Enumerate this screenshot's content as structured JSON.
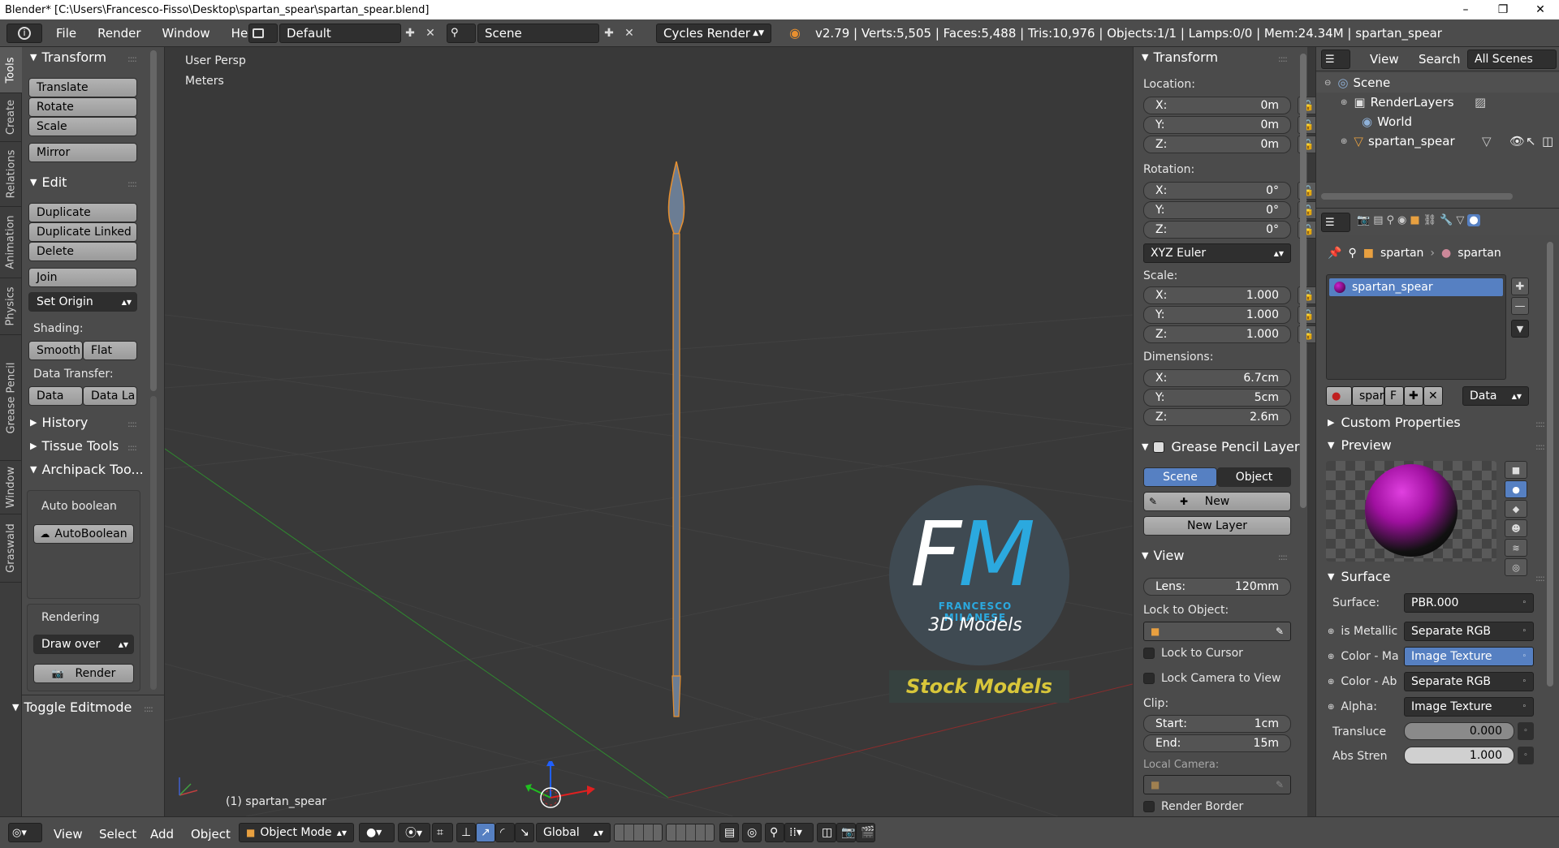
{
  "window": {
    "title": "Blender* [C:\\Users\\Francesco-Fisso\\Desktop\\spartan_spear\\spartan_spear.blend]",
    "controls": {
      "minimize": "–",
      "maximize": "❐",
      "close": "✕"
    }
  },
  "topbar": {
    "menus": [
      "File",
      "Render",
      "Window",
      "Help"
    ],
    "layout": "Default",
    "scene": "Scene",
    "engine": "Cycles Render",
    "stats": "v2.79 | Verts:5,505 | Faces:5,488 | Tris:10,976 | Objects:1/1 | Lamps:0/0 | Mem:24.34M | spartan_spear"
  },
  "tool_tabs": [
    "Tools",
    "Create",
    "Relations",
    "Animation",
    "Physics",
    "Grease Pencil",
    "Window",
    "Graswald"
  ],
  "toolshelf": {
    "transform": {
      "title": "Transform",
      "buttons": [
        "Translate",
        "Rotate",
        "Scale",
        "Mirror"
      ]
    },
    "edit": {
      "title": "Edit",
      "buttons": [
        "Duplicate",
        "Duplicate Linked",
        "Delete",
        "Join",
        "Set Origin"
      ]
    },
    "shading": {
      "label": "Shading:",
      "smooth": "Smooth",
      "flat": "Flat"
    },
    "data_transfer": {
      "label": "Data Transfer:",
      "data": "Data",
      "data_la": "Data La"
    },
    "history": "History",
    "tissue": "Tissue Tools",
    "archipack": "Archipack Too...",
    "auto_boolean_label": "Auto boolean",
    "auto_boolean_btn": "AutoBoolean",
    "rendering_label": "Rendering",
    "draw_over": "Draw over",
    "render_btn": "Render",
    "toggle_editmode": "Toggle Editmode"
  },
  "viewport": {
    "view_name": "User Persp",
    "units": "Meters",
    "object_label": "(1) spartan_spear",
    "watermark": {
      "letters": "FM",
      "name": "FRANCESCO MILANESE",
      "sub": "3D Models",
      "stock": "Stock Models"
    }
  },
  "npanel": {
    "transform_title": "Transform",
    "location_label": "Location:",
    "location": [
      {
        "axis": "X:",
        "value": "0m"
      },
      {
        "axis": "Y:",
        "value": "0m"
      },
      {
        "axis": "Z:",
        "value": "0m"
      }
    ],
    "rotation_label": "Rotation:",
    "rotation": [
      {
        "axis": "X:",
        "value": "0°"
      },
      {
        "axis": "Y:",
        "value": "0°"
      },
      {
        "axis": "Z:",
        "value": "0°"
      }
    ],
    "rotation_mode": "XYZ Euler",
    "scale_label": "Scale:",
    "scale": [
      {
        "axis": "X:",
        "value": "1.000"
      },
      {
        "axis": "Y:",
        "value": "1.000"
      },
      {
        "axis": "Z:",
        "value": "1.000"
      }
    ],
    "dimensions_label": "Dimensions:",
    "dimensions": [
      {
        "axis": "X:",
        "value": "6.7cm"
      },
      {
        "axis": "Y:",
        "value": "5cm"
      },
      {
        "axis": "Z:",
        "value": "2.6m"
      }
    ],
    "gp_title": "Grease Pencil Layer",
    "gp_scene": "Scene",
    "gp_object": "Object",
    "gp_new": "New",
    "gp_new_layer": "New Layer",
    "view_title": "View",
    "lens": {
      "label": "Lens:",
      "value": "120mm"
    },
    "lock_to_object": "Lock to Object:",
    "lock_to_cursor": "Lock to Cursor",
    "lock_camera": "Lock Camera to View",
    "clip_label": "Clip:",
    "clip_start": {
      "label": "Start:",
      "value": "1cm"
    },
    "clip_end": {
      "label": "End:",
      "value": "15m"
    },
    "local_camera": "Local Camera:",
    "render_border": "Render Border"
  },
  "outliner": {
    "view": "View",
    "search": "Search",
    "scope": "All Scenes",
    "items": [
      "Scene",
      "RenderLayers",
      "World",
      "spartan_spear"
    ]
  },
  "properties": {
    "breadcrumb": [
      "spartan",
      "spartan"
    ],
    "material_slot": "spartan_spear",
    "mat_name": "spart",
    "mat_f": "F",
    "mat_link": "Data",
    "custom_props": "Custom Properties",
    "preview": "Preview",
    "surface_title": "Surface",
    "surface_label": "Surface:",
    "surface_value": "PBR.000",
    "inputs": [
      {
        "label": "is Metallic",
        "value": "Separate RGB"
      },
      {
        "label": "Color - Ma",
        "value": "Image Texture"
      },
      {
        "label": "Color - Ab",
        "value": "Separate RGB"
      },
      {
        "label": "Alpha:",
        "value": "Image Texture"
      }
    ],
    "translucent": {
      "label": "Transluce",
      "value": "0.000"
    },
    "abs_strength": {
      "label": "Abs Stren",
      "value": "1.000"
    }
  },
  "bottombar": {
    "menus": [
      "View",
      "Select",
      "Add",
      "Object"
    ],
    "mode": "Object Mode",
    "orientation": "Global"
  },
  "colors": {
    "accent": "#5680c2",
    "bg": "#393939",
    "panel": "#4b4b4b",
    "selected_orange": "#e8902f"
  }
}
